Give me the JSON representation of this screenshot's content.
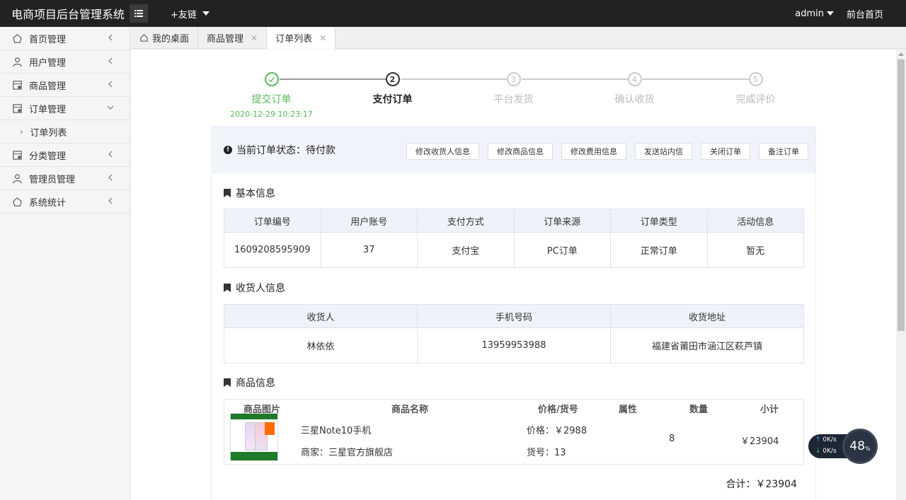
{
  "app": {
    "title": "电商项目后台管理系统"
  },
  "topbar": {
    "friend_links": "+友链",
    "user": "admin",
    "home_link": "前台首页"
  },
  "sidebar": {
    "items": [
      {
        "label": "首页管理",
        "icon": "home-icon"
      },
      {
        "label": "用户管理",
        "icon": "user-icon"
      },
      {
        "label": "商品管理",
        "icon": "goods-icon"
      },
      {
        "label": "订单管理",
        "icon": "order-icon"
      },
      {
        "label": "分类管理",
        "icon": "category-icon"
      },
      {
        "label": "管理员管理",
        "icon": "admin-icon"
      },
      {
        "label": "系统统计",
        "icon": "stats-icon"
      }
    ],
    "subitem": "订单列表"
  },
  "tabs": [
    {
      "label": "我的桌面"
    },
    {
      "label": "商品管理"
    },
    {
      "label": "订单列表"
    }
  ],
  "steps": [
    {
      "num": "1",
      "label": "提交订单",
      "time": "2020-12-29 10:23:17",
      "state": "done"
    },
    {
      "num": "2",
      "label": "支付订单",
      "state": "current"
    },
    {
      "num": "3",
      "label": "平台发货",
      "state": "todo"
    },
    {
      "num": "4",
      "label": "确认收货",
      "state": "todo"
    },
    {
      "num": "5",
      "label": "完成评价",
      "state": "todo"
    }
  ],
  "status": {
    "text": "当前订单状态：待付款",
    "buttons": [
      "修改收货人信息",
      "修改商品信息",
      "修改费用信息",
      "发送站内信",
      "关闭订单",
      "备注订单"
    ]
  },
  "basic_info": {
    "title": "基本信息",
    "headers": [
      "订单编号",
      "用户账号",
      "支付方式",
      "订单来源",
      "订单类型",
      "活动信息"
    ],
    "values": [
      "1609208595909",
      "37",
      "支付宝",
      "PC订单",
      "正常订单",
      "暂无"
    ]
  },
  "receiver_info": {
    "title": "收货人信息",
    "headers": [
      "收货人",
      "手机号码",
      "收货地址"
    ],
    "values": [
      "林依依",
      "13959953988",
      "福建省莆田市涵江区萩芦镇"
    ]
  },
  "goods_info": {
    "title": "商品信息",
    "headers": [
      "商品图片",
      "商品名称",
      "价格/货号",
      "属性",
      "数量",
      "小计"
    ],
    "name": "三星Note10手机",
    "merchant": "商家：三星官方旗舰店",
    "price": "价格：￥2988",
    "sku": "货号：13",
    "attr": "",
    "qty": "8",
    "subtotal": "￥23904"
  },
  "total": "合计：￥23904",
  "net_widget": {
    "up": "0K/s",
    "down": "0K/s",
    "percent": "48"
  },
  "colors": {
    "topbar": "#222222",
    "done": "#5cb85c",
    "status_bg": "#f0f4fa"
  }
}
